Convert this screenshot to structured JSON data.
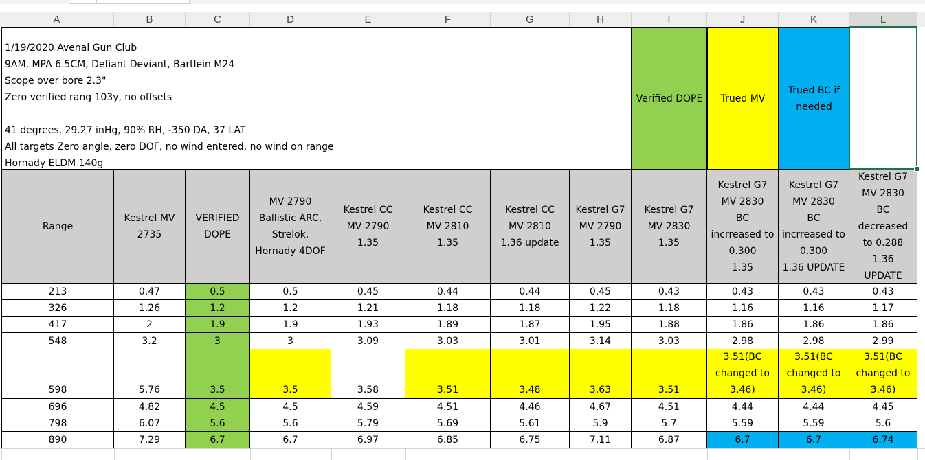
{
  "column_headers": [
    "A",
    "B",
    "C",
    "D",
    "E",
    "F",
    "G",
    "H",
    "I",
    "J",
    "K",
    "L"
  ],
  "selected_column": "L",
  "info_lines": [
    "1/19/2020 Avenal Gun Club",
    "9AM, MPA 6.5CM, Defiant Deviant, Bartlein M24",
    "Scope over bore 2.3\"",
    "Zero verified rang 103y, no offsets",
    "",
    "41 degrees, 29.27 inHg, 90% RH, -350 DA, 37 LAT",
    "All targets  Zero angle, zero DOF, no wind entered, no wind on range",
    "Hornady ELDM 140g"
  ],
  "legend": {
    "verified": "Verified DOPE",
    "trued_mv": "Trued MV",
    "trued_bc": "Trued BC if\nneeded",
    "blank": ""
  },
  "table_headers": [
    "Range",
    "Kestrel MV\n2735",
    "VERIFIED\nDOPE",
    "MV 2790\nBallistic ARC,\nStrelok,\nHornady 4DOF",
    "Kestrel CC\nMV 2790\n1.35",
    "Kestrel CC\nMV 2810\n1.35",
    "Kestrel CC\nMV 2810\n1.36 update",
    "Kestrel G7\nMV 2790\n1.35",
    "Kestrel G7\nMV 2830\n1.35",
    "Kestrel G7\nMV 2830\nBC\nincrreased to\n0.300\n1.35",
    "Kestrel G7\nMV 2830\nBC\nincrreased to\n0.300\n1.36 UPDATE",
    "Kestrel G7\nMV 2830\nBC\ndecreased\nto 0.288\n1.36\nUPDATE"
  ],
  "rows": [
    [
      "213",
      "0.47",
      "0.5",
      "0.5",
      "0.45",
      "0.44",
      "0.44",
      "0.45",
      "0.43",
      "0.43",
      "0.43",
      "0.43"
    ],
    [
      "326",
      "1.26",
      "1.2",
      "1.2",
      "1.21",
      "1.18",
      "1.18",
      "1.22",
      "1.18",
      "1.16",
      "1.16",
      "1.17"
    ],
    [
      "417",
      "2",
      "1.9",
      "1.9",
      "1.93",
      "1.89",
      "1.87",
      "1.95",
      "1.88",
      "1.86",
      "1.86",
      "1.86"
    ],
    [
      "548",
      "3.2",
      "3",
      "3",
      "3.09",
      "3.03",
      "3.01",
      "3.14",
      "3.03",
      "2.98",
      "2.98",
      "2.99"
    ],
    [
      "598",
      "5.76",
      "3.5",
      "3.5",
      "3.58",
      "3.51",
      "3.48",
      "3.63",
      "3.51",
      "3.51(BC\nchanged to\n3.46)",
      "3.51(BC\nchanged to\n3.46)",
      "3.51(BC\nchanged to\n3.46)"
    ],
    [
      "696",
      "4.82",
      "4.5",
      "4.5",
      "4.59",
      "4.51",
      "4.46",
      "4.67",
      "4.51",
      "4.44",
      "4.44",
      "4.45"
    ],
    [
      "798",
      "6.07",
      "5.6",
      "5.6",
      "5.79",
      "5.69",
      "5.61",
      "5.9",
      "5.7",
      "5.59",
      "5.59",
      "5.6"
    ],
    [
      "890",
      "7.29",
      "6.7",
      "6.7",
      "6.97",
      "6.85",
      "6.75",
      "7.11",
      "6.87",
      "6.7",
      "6.7",
      "6.74"
    ]
  ],
  "colors": {
    "green": "#92d050",
    "yellow": "#ffff00",
    "blue": "#00b0f0",
    "header_gray": "#d0cece",
    "selection": "#217346"
  }
}
